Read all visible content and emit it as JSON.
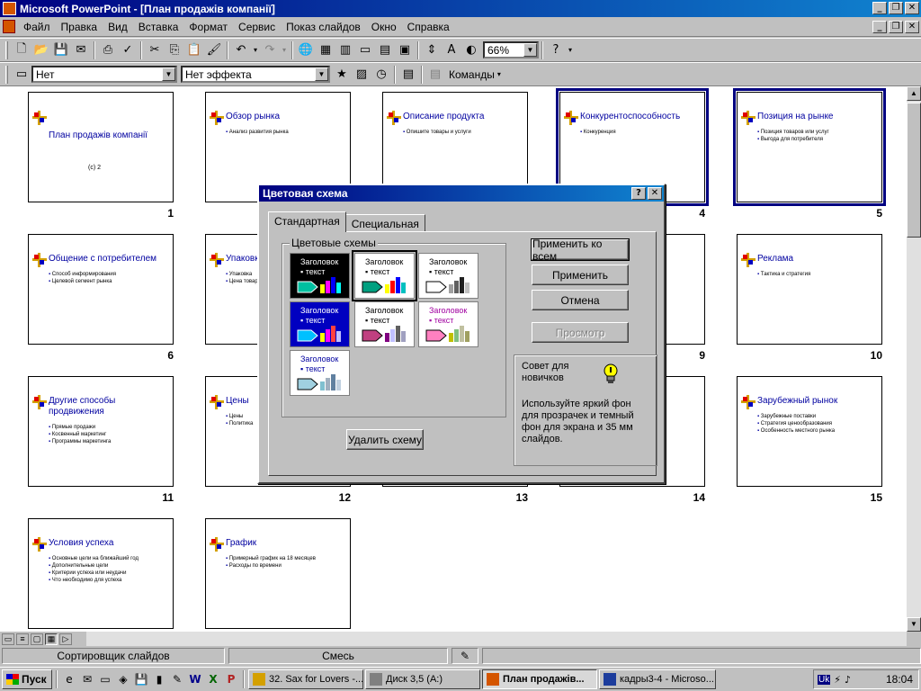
{
  "app": {
    "title": "Microsoft PowerPoint - [План продажів компанії]"
  },
  "menu": [
    "Файл",
    "Правка",
    "Вид",
    "Вставка",
    "Формат",
    "Сервис",
    "Показ слайдов",
    "Окно",
    "Справка"
  ],
  "toolbar": {
    "zoom": "66%",
    "transition_effect": "Нет",
    "text_effect": "Нет эффекта",
    "commands_label": "Команды"
  },
  "slides": [
    {
      "num": "1",
      "title": "План продажів компанії",
      "bullets": [],
      "subtitle": "(c) 2"
    },
    {
      "num": "2",
      "title": "Обзор рынка",
      "bullets": [
        "Анализ развития рынка"
      ]
    },
    {
      "num": "3",
      "title": "Описание продукта",
      "bullets": [
        "Опишите товары и услуги"
      ]
    },
    {
      "num": "4",
      "title": "Конкурентоспособность",
      "bullets": [
        "Конкуренция"
      ]
    },
    {
      "num": "5",
      "title": "Позиция на рынке",
      "bullets": [
        "Позиция товаров или услуг",
        "Выгода для потребителя"
      ]
    },
    {
      "num": "6",
      "title": "Общение с потребителем",
      "bullets": [
        "Способ информирования",
        "Целевой сегмент рынка"
      ]
    },
    {
      "num": "7",
      "title": "Упаковка",
      "bullets": [
        "Упаковка",
        "Цена товара"
      ]
    },
    {
      "num": "8",
      "title": "",
      "bullets": []
    },
    {
      "num": "9",
      "title": "стью",
      "bullets": []
    },
    {
      "num": "10",
      "title": "Реклама",
      "bullets": [
        "Тактика и стратегия"
      ]
    },
    {
      "num": "11",
      "title": "Другие способы продвижения",
      "bullets": [
        "Прямые продажи",
        "Косвенный маркетинг",
        "Программы маркетинга"
      ]
    },
    {
      "num": "12",
      "title": "Цены",
      "bullets": [
        "Цены",
        "Политика"
      ]
    },
    {
      "num": "13",
      "title": "",
      "bullets": []
    },
    {
      "num": "14",
      "title": "или",
      "bullets": []
    },
    {
      "num": "15",
      "title": "Зарубежный рынок",
      "bullets": [
        "Зарубежные поставки",
        "Стратегия ценообразования",
        "Особенность местного рынка"
      ]
    },
    {
      "num": "16",
      "title": "Условия успеха",
      "bullets": [
        "Основные цели на ближайший год",
        "Дополнительные цели",
        "Критерии успеха или неудачи",
        "Что необходимо для успеха"
      ]
    },
    {
      "num": "17",
      "title": "График",
      "bullets": [
        "Примерный график на 18 месяцев",
        "Расходы по времени"
      ]
    }
  ],
  "dialog": {
    "title": "Цветовая схема",
    "tabs": [
      "Стандартная",
      "Специальная"
    ],
    "group_label": "Цветовые схемы",
    "scheme_heading": "Заголовок",
    "scheme_text": "текст",
    "buttons": {
      "apply_all": "Применить ко всем",
      "apply": "Применить",
      "cancel": "Отмена",
      "preview": "Просмотр",
      "delete_scheme": "Удалить схему"
    },
    "tip_title": "Совет для новичков",
    "tip_text": "Используйте яркий фон для прозрачек и темный фон для экрана и 35 мм слайдов."
  },
  "status": {
    "view": "Сортировщик слайдов",
    "design": "Смесь"
  },
  "taskbar": {
    "start": "Пуск",
    "tasks": [
      "32. Sax for Lovers -...",
      "Диск 3,5 (A:)",
      "План продажів...",
      "кадры3-4 - Microso..."
    ],
    "lang": "Uk",
    "clock": "18:04"
  }
}
